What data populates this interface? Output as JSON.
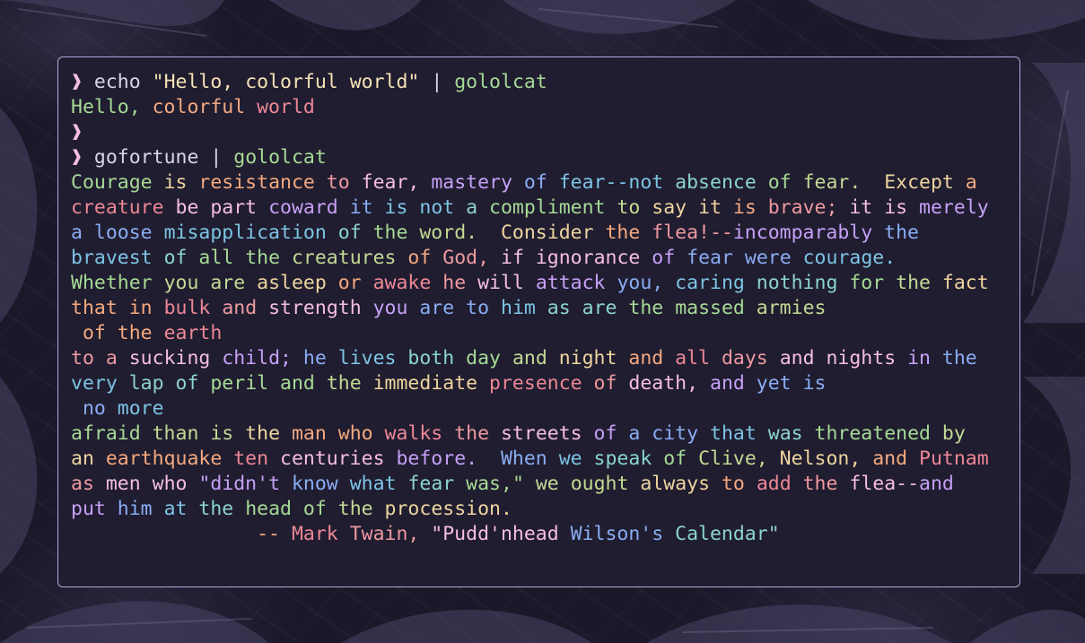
{
  "terminal": {
    "prompt_symbol": "❱",
    "commands": [
      {
        "name": "echo",
        "argument": "\"Hello, colorful world\"",
        "pipe": "|",
        "filter": "gololcat",
        "output": [
          [
            [
              "Hello, ",
              "#a6da95"
            ],
            [
              "colorful ",
              "#f5a97f"
            ],
            [
              "world",
              "#ed8796"
            ]
          ]
        ]
      },
      {
        "empty": true
      },
      {
        "name": "gofortune",
        "pipe": "|",
        "filter": "gololcat",
        "output": [
          [
            [
              "Courage ",
              "#a6da95"
            ],
            [
              "is ",
              "#eed49f"
            ],
            [
              "resistance ",
              "#f5a97f"
            ],
            [
              "to ",
              "#ee99a0"
            ],
            [
              "fear, ",
              "#f5bde6"
            ],
            [
              "mastery ",
              "#c6a0f6"
            ],
            [
              "of ",
              "#8aadf4"
            ],
            [
              "fear--not ",
              "#7dc4e4"
            ],
            [
              "absence ",
              "#8bd5ca"
            ],
            [
              "of ",
              "#a6da95"
            ],
            [
              "fear.  ",
              "#c2d994"
            ],
            [
              "Except ",
              "#eed49f"
            ],
            [
              "a",
              "#f5a97f"
            ]
          ],
          [
            [
              "creature ",
              "#ed8796"
            ],
            [
              "be ",
              "#f5bde6"
            ],
            [
              "part ",
              "#f5bde6"
            ],
            [
              "coward ",
              "#c6a0f6"
            ],
            [
              "it ",
              "#8aadf4"
            ],
            [
              "is ",
              "#7dc4e4"
            ],
            [
              "not ",
              "#7dc4e4"
            ],
            [
              "a ",
              "#8bd5ca"
            ],
            [
              "compliment ",
              "#a6da95"
            ],
            [
              "to ",
              "#c2d994"
            ],
            [
              "say ",
              "#eed49f"
            ],
            [
              "it ",
              "#eed49f"
            ],
            [
              "is ",
              "#f5a97f"
            ],
            [
              "brave; ",
              "#ee99a0"
            ],
            [
              "it ",
              "#f5bde6"
            ],
            [
              "is ",
              "#f5bde6"
            ],
            [
              "merely",
              "#c6a0f6"
            ]
          ],
          [
            [
              "a ",
              "#8aadf4"
            ],
            [
              "loose ",
              "#8aadf4"
            ],
            [
              "misapplication ",
              "#7dc4e4"
            ],
            [
              "of ",
              "#8bd5ca"
            ],
            [
              "the ",
              "#a6da95"
            ],
            [
              "word.  ",
              "#c2d994"
            ],
            [
              "Consider ",
              "#eed49f"
            ],
            [
              "the ",
              "#f5a97f"
            ],
            [
              "flea!--",
              "#ee99a0"
            ],
            [
              "incomparably ",
              "#c6a0f6"
            ],
            [
              "the",
              "#8aadf4"
            ]
          ],
          [
            [
              "bravest ",
              "#7dc4e4"
            ],
            [
              "of ",
              "#8bd5ca"
            ],
            [
              "all ",
              "#a6da95"
            ],
            [
              "the ",
              "#a6da95"
            ],
            [
              "creatures ",
              "#c2d994"
            ],
            [
              "of ",
              "#f5a97f"
            ],
            [
              "God, ",
              "#ee99a0"
            ],
            [
              "if ",
              "#f5bde6"
            ],
            [
              "ignorance ",
              "#f5bde6"
            ],
            [
              "of ",
              "#c6a0f6"
            ],
            [
              "fear ",
              "#8aadf4"
            ],
            [
              "were ",
              "#8aadf4"
            ],
            [
              "courage.",
              "#7dc4e4"
            ]
          ],
          [
            [
              "Whether ",
              "#a6da95"
            ],
            [
              "you ",
              "#c2d994"
            ],
            [
              "are ",
              "#c2d994"
            ],
            [
              "asleep ",
              "#eed49f"
            ],
            [
              "or ",
              "#f5a97f"
            ],
            [
              "awake ",
              "#ed8796"
            ],
            [
              "he ",
              "#ee99a0"
            ],
            [
              "will ",
              "#f5bde6"
            ],
            [
              "attack ",
              "#c6a0f6"
            ],
            [
              "you, ",
              "#8aadf4"
            ],
            [
              "caring ",
              "#7dc4e4"
            ],
            [
              "nothing ",
              "#8bd5ca"
            ],
            [
              "for ",
              "#a6da95"
            ],
            [
              "the ",
              "#c2d994"
            ],
            [
              "fact",
              "#eed49f"
            ]
          ],
          [
            [
              "that ",
              "#f5a97f"
            ],
            [
              "in ",
              "#f5a97f"
            ],
            [
              "bulk ",
              "#ed8796"
            ],
            [
              "and ",
              "#ee99a0"
            ],
            [
              "strength ",
              "#f5bde6"
            ],
            [
              "you ",
              "#c6a0f6"
            ],
            [
              "are ",
              "#8aadf4"
            ],
            [
              "to ",
              "#8aadf4"
            ],
            [
              "him ",
              "#7dc4e4"
            ],
            [
              "as ",
              "#8bd5ca"
            ],
            [
              "are ",
              "#8bd5ca"
            ],
            [
              "the ",
              "#a6da95"
            ],
            [
              "massed ",
              "#a6da95"
            ],
            [
              "armies",
              "#c2d994"
            ]
          ],
          [
            [
              " of ",
              "#f5a97f"
            ],
            [
              "the ",
              "#f5a97f"
            ],
            [
              "earth",
              "#ed8796"
            ]
          ],
          [
            [
              "to ",
              "#ee99a0"
            ],
            [
              "a ",
              "#ee99a0"
            ],
            [
              "sucking ",
              "#f5bde6"
            ],
            [
              "child; ",
              "#c6a0f6"
            ],
            [
              "he ",
              "#8aadf4"
            ],
            [
              "lives ",
              "#7dc4e4"
            ],
            [
              "both ",
              "#8bd5ca"
            ],
            [
              "day ",
              "#a6da95"
            ],
            [
              "and ",
              "#c2d994"
            ],
            [
              "night ",
              "#eed49f"
            ],
            [
              "and ",
              "#f5a97f"
            ],
            [
              "all ",
              "#ed8796"
            ],
            [
              "days ",
              "#ee99a0"
            ],
            [
              "and ",
              "#f5bde6"
            ],
            [
              "nights ",
              "#f5bde6"
            ],
            [
              "in ",
              "#c6a0f6"
            ],
            [
              "the",
              "#8aadf4"
            ]
          ],
          [
            [
              "very ",
              "#7dc4e4"
            ],
            [
              "lap ",
              "#8bd5ca"
            ],
            [
              "of ",
              "#8bd5ca"
            ],
            [
              "peril ",
              "#a6da95"
            ],
            [
              "and ",
              "#a6da95"
            ],
            [
              "the ",
              "#c2d994"
            ],
            [
              "immediate ",
              "#eed49f"
            ],
            [
              "presence ",
              "#ed8796"
            ],
            [
              "of ",
              "#ee99a0"
            ],
            [
              "death, ",
              "#f5bde6"
            ],
            [
              "and ",
              "#c6a0f6"
            ],
            [
              "yet ",
              "#8aadf4"
            ],
            [
              "is",
              "#8aadf4"
            ]
          ],
          [
            [
              " no ",
              "#8aadf4"
            ],
            [
              "more",
              "#7dc4e4"
            ]
          ],
          [
            [
              "afraid ",
              "#a6da95"
            ],
            [
              "than ",
              "#c2d994"
            ],
            [
              "is ",
              "#c2d994"
            ],
            [
              "the ",
              "#eed49f"
            ],
            [
              "man ",
              "#f5a97f"
            ],
            [
              "who ",
              "#f5a97f"
            ],
            [
              "walks ",
              "#ed8796"
            ],
            [
              "the ",
              "#ee99a0"
            ],
            [
              "streets ",
              "#f5bde6"
            ],
            [
              "of ",
              "#c6a0f6"
            ],
            [
              "a ",
              "#8aadf4"
            ],
            [
              "city ",
              "#8aadf4"
            ],
            [
              "that ",
              "#7dc4e4"
            ],
            [
              "was ",
              "#8bd5ca"
            ],
            [
              "threatened ",
              "#a6da95"
            ],
            [
              "by",
              "#c2d994"
            ]
          ],
          [
            [
              "an ",
              "#eed49f"
            ],
            [
              "earthquake ",
              "#f5a97f"
            ],
            [
              "ten ",
              "#ed8796"
            ],
            [
              "centuries ",
              "#f5bde6"
            ],
            [
              "before.  ",
              "#c6a0f6"
            ],
            [
              "When ",
              "#8aadf4"
            ],
            [
              "we ",
              "#7dc4e4"
            ],
            [
              "speak ",
              "#8bd5ca"
            ],
            [
              "of ",
              "#a6da95"
            ],
            [
              "Clive, ",
              "#c2d994"
            ],
            [
              "Nelson, ",
              "#eed49f"
            ],
            [
              "and ",
              "#f5a97f"
            ],
            [
              "Putnam",
              "#ed8796"
            ]
          ],
          [
            [
              "as ",
              "#ee99a0"
            ],
            [
              "men ",
              "#f5bde6"
            ],
            [
              "who ",
              "#f5bde6"
            ],
            [
              "\"didn't ",
              "#c6a0f6"
            ],
            [
              "know ",
              "#8aadf4"
            ],
            [
              "what ",
              "#7dc4e4"
            ],
            [
              "fear ",
              "#8bd5ca"
            ],
            [
              "was,\" ",
              "#a6da95"
            ],
            [
              "we ",
              "#c2d994"
            ],
            [
              "ought ",
              "#c2d994"
            ],
            [
              "always ",
              "#eed49f"
            ],
            [
              "to ",
              "#f5a97f"
            ],
            [
              "add ",
              "#ed8796"
            ],
            [
              "the ",
              "#ee99a0"
            ],
            [
              "flea--",
              "#f5bde6"
            ],
            [
              "and",
              "#c6a0f6"
            ]
          ],
          [
            [
              "put ",
              "#c6a0f6"
            ],
            [
              "him ",
              "#8aadf4"
            ],
            [
              "at ",
              "#7dc4e4"
            ],
            [
              "the ",
              "#8bd5ca"
            ],
            [
              "head ",
              "#a6da95"
            ],
            [
              "of ",
              "#a6da95"
            ],
            [
              "the ",
              "#c2d994"
            ],
            [
              "procession.",
              "#eed49f"
            ]
          ],
          [
            [
              "                -- ",
              "#f5a97f"
            ],
            [
              "Mark ",
              "#ed8796"
            ],
            [
              "Twain, ",
              "#ee99a0"
            ],
            [
              "\"Pudd'nhead ",
              "#f5bde6"
            ],
            [
              "Wilson's ",
              "#8aadf4"
            ],
            [
              "Calendar\"",
              "#8bd5ca"
            ]
          ]
        ]
      }
    ]
  }
}
